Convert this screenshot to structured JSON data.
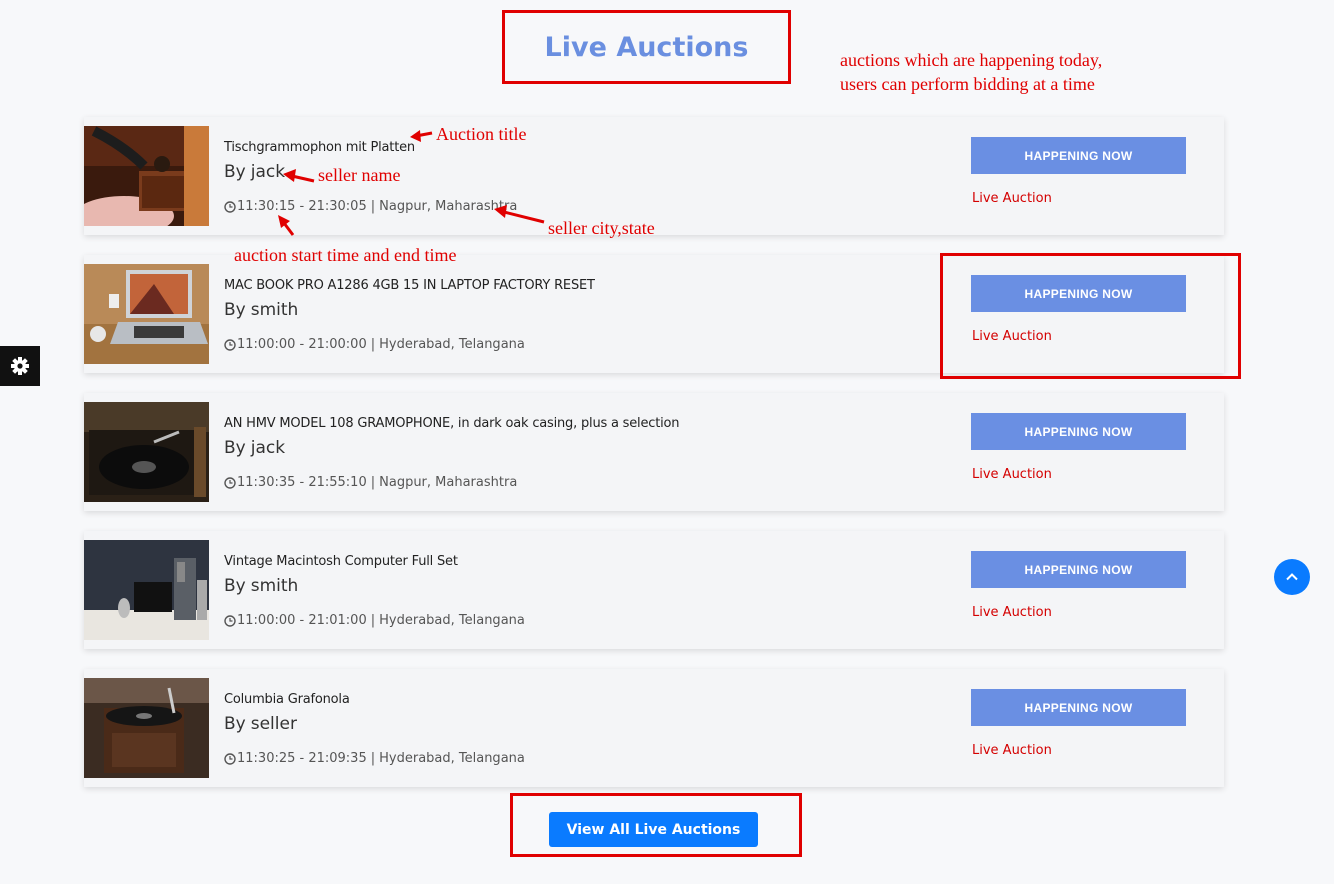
{
  "page": {
    "title": "Live Auctions",
    "view_all_label": "View All Live Auctions"
  },
  "annotations": {
    "header_note_line1": "auctions which are happening today,",
    "header_note_line2": "users can perform bidding at a time",
    "auction_title": "Auction title",
    "seller_name": "seller name",
    "seller_city_state": "seller city,state",
    "start_end_time": "auction start time and end time"
  },
  "auctions": [
    {
      "title": "Tischgrammophon mit Platten",
      "by": "By",
      "seller": "jack",
      "time": "11:30:15 - 21:30:05",
      "location": "Nagpur, Maharashtra",
      "button": "HAPPENING NOW",
      "status": "Live Auction"
    },
    {
      "title": "MAC BOOK PRO A1286 4GB 15 IN LAPTOP FACTORY RESET",
      "by": "By",
      "seller": "smith",
      "time": "11:00:00 - 21:00:00",
      "location": "Hyderabad, Telangana",
      "button": "HAPPENING NOW",
      "status": "Live Auction"
    },
    {
      "title": "AN HMV MODEL 108 GRAMOPHONE, in dark oak casing, plus a selection",
      "by": "By",
      "seller": "jack",
      "time": "11:30:35 - 21:55:10",
      "location": "Nagpur, Maharashtra",
      "button": "HAPPENING NOW",
      "status": "Live Auction"
    },
    {
      "title": "Vintage Macintosh Computer Full Set",
      "by": "By",
      "seller": "smith",
      "time": "11:00:00 - 21:01:00",
      "location": "Hyderabad, Telangana",
      "button": "HAPPENING NOW",
      "status": "Live Auction"
    },
    {
      "title": "Columbia Grafonola",
      "by": "By",
      "seller": "seller",
      "time": "11:30:25 - 21:09:35",
      "location": "Hyderabad, Telangana",
      "button": "HAPPENING NOW",
      "status": "Live Auction"
    }
  ],
  "icons": {
    "settings": "gear-icon",
    "scroll_top": "chevron-up-icon",
    "clock": "clock-icon"
  },
  "colors": {
    "accent": "#6a8fe3",
    "primary": "#0a7bff",
    "live": "#d40000",
    "annotation": "#e00000"
  }
}
